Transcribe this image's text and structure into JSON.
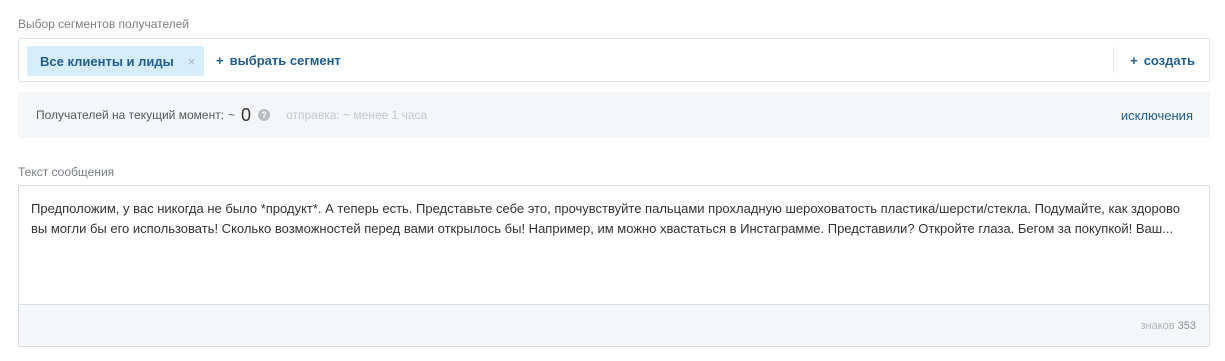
{
  "segments": {
    "label": "Выбор сегментов получателей",
    "chip_label": "Все клиенты и лиды",
    "chip_remove": "×",
    "add_label": "выбрать сегмент",
    "create_label": "создать",
    "plus": "+"
  },
  "recipients": {
    "label": "Получателей на текущий момент:",
    "tilde": "~",
    "count": "0",
    "help": "?",
    "send_time": "отправка: ~ менее 1 часа",
    "exclusions_label": "исключения"
  },
  "message": {
    "label": "Текст сообщения",
    "text": "Предположим, у вас никогда не было *продукт*. А теперь есть. Представьте себе это, прочувствуйте пальцами прохладную шероховатость пластика/шерсти/стекла. Подумайте, как здорово вы могли бы его использовать! Сколько возможностей перед вами открылось бы! Например, им можно хвастаться в Инстаграмме. Представили? Откройте глаза. Бегом за покупкой! Ваш...",
    "char_count_label": "знаков",
    "char_count": "353"
  },
  "colors": {
    "accent": "#1f5e8e",
    "chip_bg": "#d6edfb",
    "panel_bg": "#f5f6f8"
  }
}
